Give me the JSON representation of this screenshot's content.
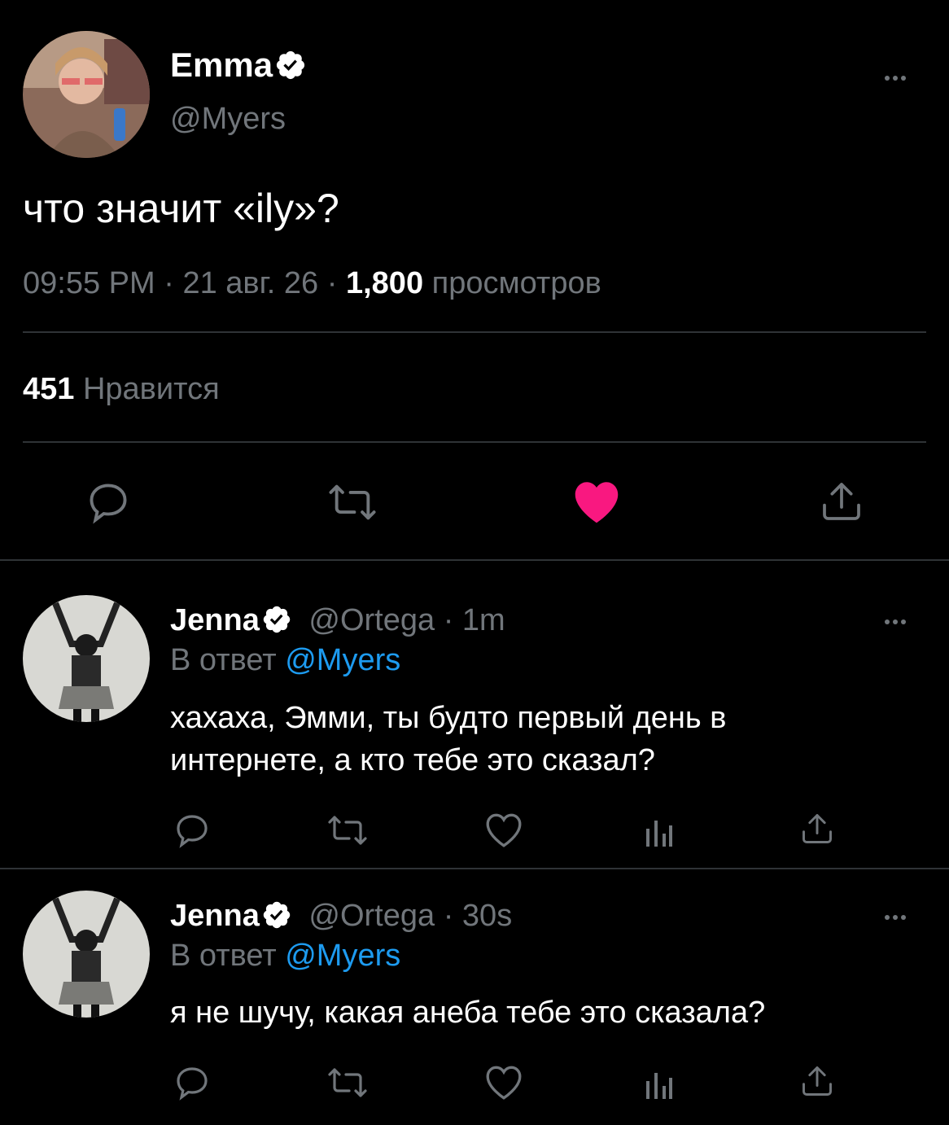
{
  "main_tweet": {
    "display_name": "Emma",
    "handle": "@Myers",
    "text": "что значит «ily»?",
    "time": "09:55 PM",
    "date": "21 авг. 26",
    "separator": "·",
    "views_count": "1,800",
    "views_label": "просмотров",
    "likes_count": "451",
    "likes_label": "Нравится"
  },
  "replies": [
    {
      "display_name": "Jenna",
      "handle": "@Ortega",
      "time": "1m",
      "separator": "·",
      "reply_to_label": "В ответ",
      "reply_to_handle": "@Myers",
      "text_line1": "хахаха, Эмми, ты будто первый день в",
      "text_line2": "интернете, а кто тебе это сказал?"
    },
    {
      "display_name": "Jenna",
      "handle": "@Ortega",
      "time": "30s",
      "separator": "·",
      "reply_to_label": "В ответ",
      "reply_to_handle": "@Myers",
      "text_line1": "я не шучу, какая анеба тебе это сказала?"
    }
  ],
  "colors": {
    "background": "#000000",
    "text": "#e7e9ea",
    "muted": "#71767b",
    "accent": "#1d9bf0",
    "like": "#f91880",
    "verified": "#ffffff"
  },
  "icons": {
    "reply": "speech-bubble-icon",
    "retweet": "retweet-icon",
    "like": "heart-icon",
    "views": "bar-chart-icon",
    "share": "share-upload-icon",
    "more": "more-dots-icon",
    "verified": "verified-badge-icon"
  }
}
